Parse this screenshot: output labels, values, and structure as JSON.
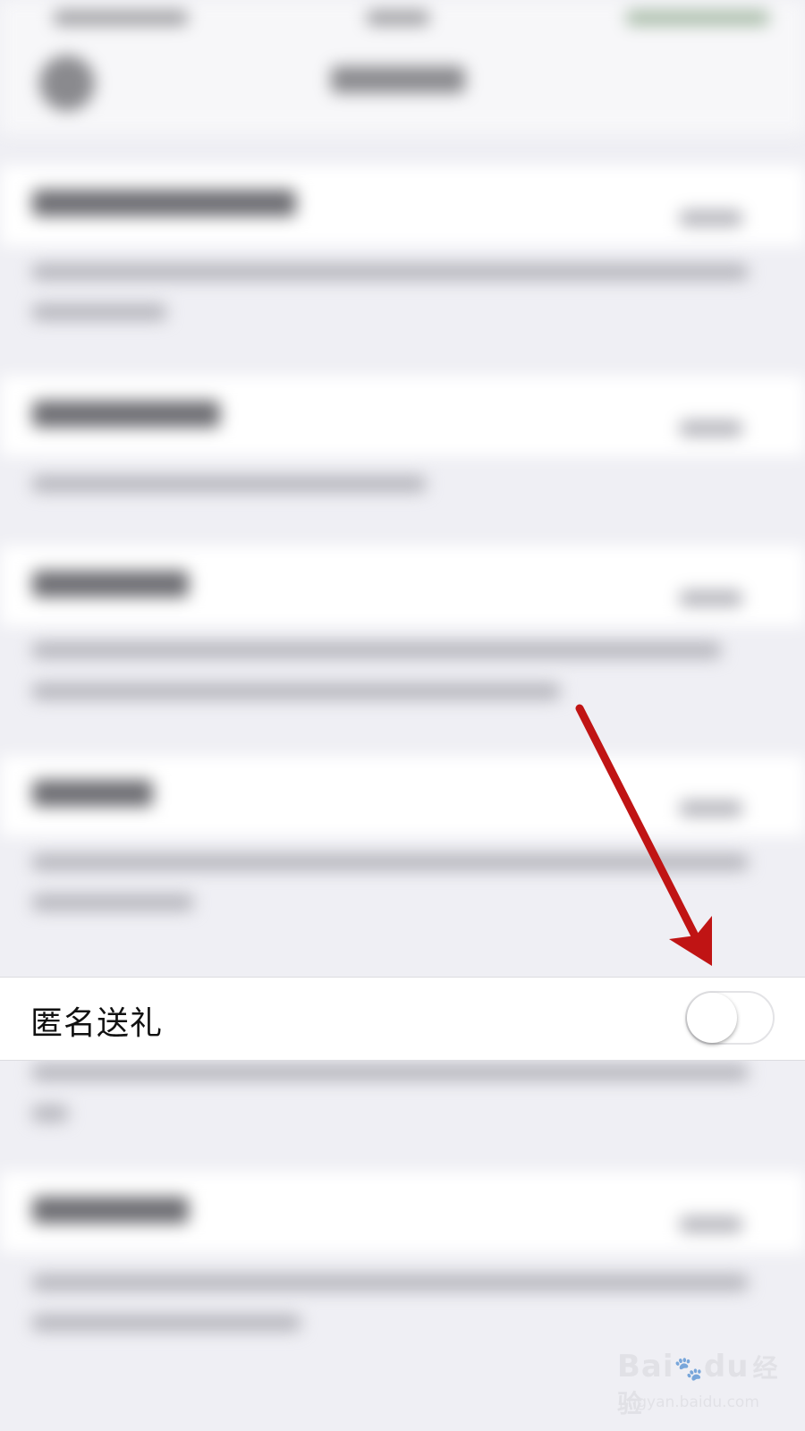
{
  "setting": {
    "label": "匿名送礼",
    "enabled": false
  },
  "annotation": {
    "arrow_color": "#c01414",
    "points_to": "toggle-switch"
  },
  "watermark": {
    "brand": "Bai",
    "brand_suffix": "du",
    "brand_cn": "经验",
    "url": "jingyan.baidu.com"
  },
  "colors": {
    "page_background": "#efeff4",
    "row_background": "#ffffff",
    "label_text": "#111111"
  }
}
